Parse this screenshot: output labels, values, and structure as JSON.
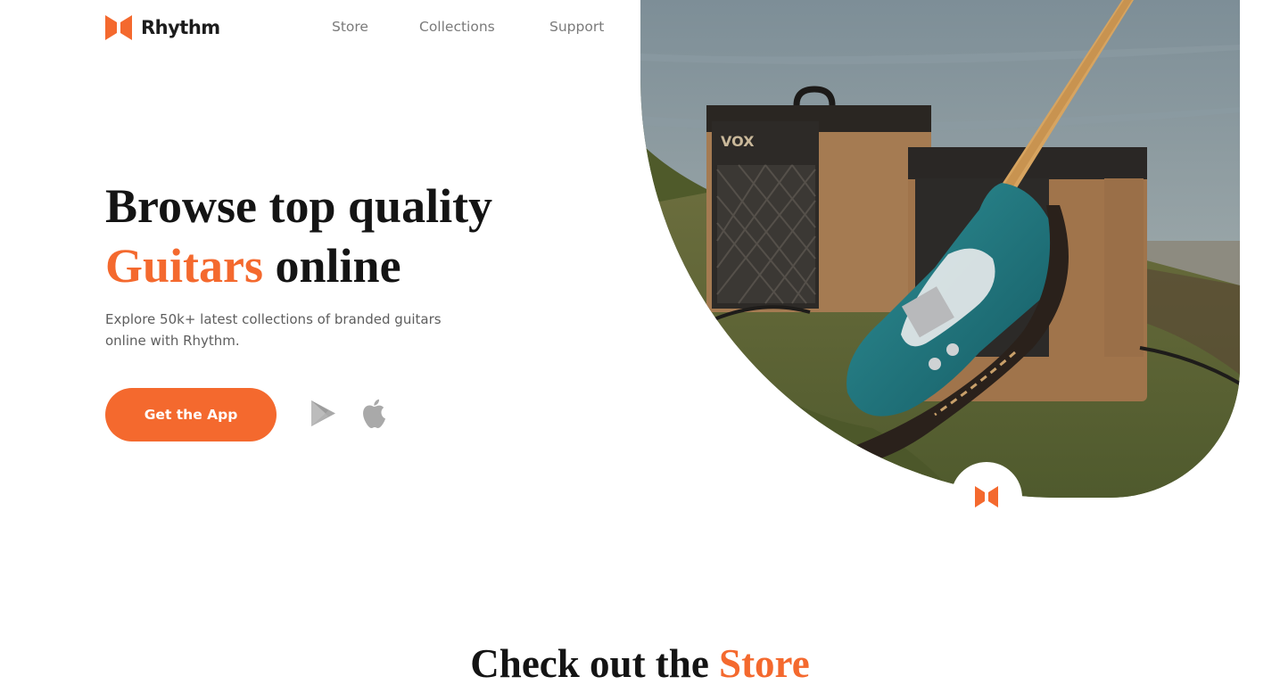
{
  "brand": {
    "name": "Rhythm",
    "logo_icon": "rhythm-logo-icon",
    "accent_color": "#f4692e"
  },
  "nav": {
    "items": [
      {
        "label": "Store"
      },
      {
        "label": "Collections"
      },
      {
        "label": "Support"
      }
    ]
  },
  "hero": {
    "title_line1": "Browse top quality",
    "title_accent": "Guitars",
    "title_rest": " online",
    "subtitle": "Explore 50k+ latest collections of branded guitars online with Rhythm.",
    "cta_label": "Get the App",
    "store_icons": [
      "google-play-icon",
      "apple-icon"
    ],
    "image": "guitar-and-amplifiers-photo"
  },
  "section": {
    "title_prefix": "Check out the ",
    "title_accent": "Store"
  }
}
